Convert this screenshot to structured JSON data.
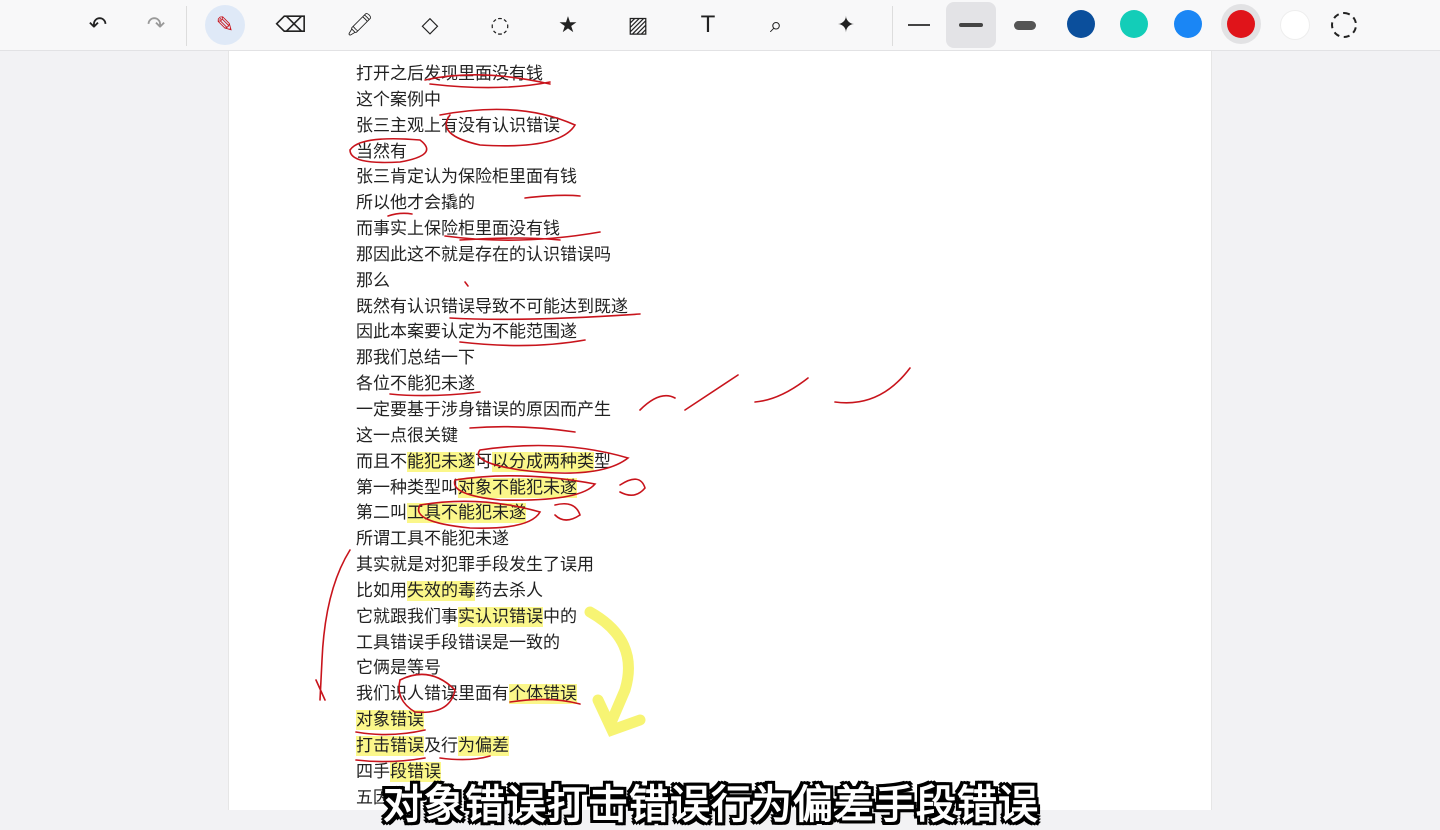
{
  "toolbar": {
    "tools": [
      {
        "name": "undo-icon",
        "glyph": "↶"
      },
      {
        "name": "redo-icon",
        "glyph": "↷"
      },
      {
        "name": "pen-icon",
        "glyph": "✎"
      },
      {
        "name": "eraser-icon",
        "glyph": "⌫"
      },
      {
        "name": "highlighter-icon",
        "glyph": "🖍"
      },
      {
        "name": "shapes-icon",
        "glyph": "◇"
      },
      {
        "name": "lasso-icon",
        "glyph": "◌"
      },
      {
        "name": "sticker-icon",
        "glyph": "★"
      },
      {
        "name": "image-icon",
        "glyph": "▨"
      },
      {
        "name": "text-icon",
        "glyph": "T"
      },
      {
        "name": "image-search-icon",
        "glyph": "⌕"
      },
      {
        "name": "laser-pointer-icon",
        "glyph": "✦"
      }
    ],
    "colors": [
      "#0b4f9c",
      "#13cdb8",
      "#1a86f5",
      "#e0141a",
      "#ffffff"
    ],
    "selected_color": "#e0141a"
  },
  "document": {
    "lines": [
      [
        {
          "t": "打开之后发现里面没有钱"
        }
      ],
      [
        {
          "t": "这个案例中"
        }
      ],
      [
        {
          "t": "张三主观上有没有认识错误"
        }
      ],
      [
        {
          "t": "当然有"
        }
      ],
      [
        {
          "t": "张三肯定认为保险柜里面有钱"
        }
      ],
      [
        {
          "t": "所以他才会撬的"
        }
      ],
      [
        {
          "t": "而事实上保险柜里面没有钱"
        }
      ],
      [
        {
          "t": "那因此这不就是存在的认识错误吗"
        }
      ],
      [
        {
          "t": "那么"
        }
      ],
      [
        {
          "t": "既然有认识错误导致不可能达到既遂"
        }
      ],
      [
        {
          "t": "因此本案要认定为不能范围遂"
        }
      ],
      [
        {
          "t": "那我们总结一下"
        }
      ],
      [
        {
          "t": "各位不能犯未遂"
        }
      ],
      [
        {
          "t": "一定要基于涉身错误的原因而产生"
        }
      ],
      [
        {
          "t": "这一点很关键"
        }
      ],
      [
        {
          "t": "而且不"
        },
        {
          "t": "能犯未遂",
          "hl": true
        },
        {
          "t": "可"
        },
        {
          "t": "以分成两种类",
          "hl": true
        },
        {
          "t": "型"
        }
      ],
      [
        {
          "t": "第一种类型叫"
        },
        {
          "t": "对象不能犯未遂",
          "hl": true
        }
      ],
      [
        {
          "t": "第二叫"
        },
        {
          "t": "工具不能犯未遂",
          "hl": true
        }
      ],
      [
        {
          "t": "所谓工具不能犯未遂"
        }
      ],
      [
        {
          "t": "其实就是对犯罪手段发生了误用"
        }
      ],
      [
        {
          "t": "比如用"
        },
        {
          "t": "失效的毒",
          "hl": true
        },
        {
          "t": "药去杀人"
        }
      ],
      [
        {
          "t": "它就跟我们事"
        },
        {
          "t": "实认识错误",
          "hl": true
        },
        {
          "t": "中的"
        }
      ],
      [
        {
          "t": "工具错误手段错误是一致的"
        }
      ],
      [
        {
          "t": "它俩是等号"
        }
      ],
      [
        {
          "t": "我们识人错误里面有"
        },
        {
          "t": "个体错误",
          "hl": true
        }
      ],
      [
        {
          "t": "对象错误",
          "hl": true
        }
      ],
      [
        {
          "t": "打击错误",
          "hl": true
        },
        {
          "t": "及行"
        },
        {
          "t": "为偏差",
          "hl": true
        }
      ],
      [
        {
          "t": "四手"
        },
        {
          "t": "段错误",
          "hl": true
        }
      ],
      [
        {
          "t": "五因"
        }
      ]
    ]
  },
  "subtitle": "对象错误打击错误行为偏差手段错误"
}
